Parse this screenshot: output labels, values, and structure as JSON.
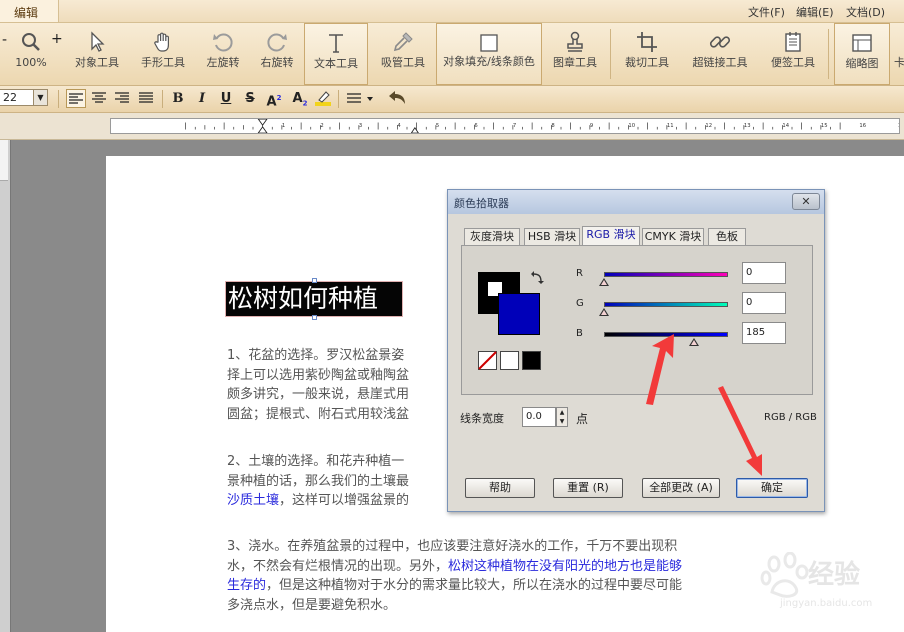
{
  "menubar": {
    "tab_label": "编辑",
    "items": [
      "文件(F)",
      "编辑(E)",
      "文档(D)"
    ]
  },
  "toolbar": {
    "zoom": {
      "minus": "-",
      "plus": "+",
      "value": "100%"
    },
    "tools": [
      {
        "label": "对象工具",
        "icon": "cursor-icon"
      },
      {
        "label": "手形工具",
        "icon": "hand-icon"
      },
      {
        "label": "左旋转",
        "icon": "rotate-left-icon"
      },
      {
        "label": "右旋转",
        "icon": "rotate-right-icon"
      },
      {
        "label": "文本工具",
        "icon": "text-icon"
      },
      {
        "label": "吸管工具",
        "icon": "eyedropper-icon"
      },
      {
        "label": "对象填充/线条颜色",
        "icon": "fill-box-icon"
      },
      {
        "label": "图章工具",
        "icon": "stamp-icon"
      },
      {
        "label": "裁切工具",
        "icon": "crop-icon"
      },
      {
        "label": "超链接工具",
        "icon": "link-icon"
      },
      {
        "label": "便签工具",
        "icon": "note-icon"
      },
      {
        "label": "缩略图",
        "icon": "thumbnail-icon"
      },
      {
        "label": "卡",
        "icon": "card-icon"
      }
    ]
  },
  "formatbar": {
    "font_size": "22",
    "bold": "B",
    "italic": "I",
    "underline": "U",
    "strike": "S",
    "superscript": "A",
    "subscript": "A",
    "sup_mark": "2",
    "sub_mark": "2"
  },
  "ruler": {
    "numbers": [
      "1",
      "2",
      "3",
      "4",
      "5",
      "6",
      "7",
      "8",
      "9",
      "10",
      "11",
      "12",
      "13",
      "14",
      "15",
      "16",
      "17"
    ]
  },
  "document": {
    "title": "松树如何种植",
    "para1": [
      "1、花盆的选择。罗汉松盆景姿",
      "择上可以选用紫砂陶盆或釉陶盆",
      "颇多讲究，一般来说，悬崖式用",
      "圆盆；提根式、附石式用较浅盆"
    ],
    "para2_lines": [
      "2、土壤的选择。和花卉种植一",
      "景种植的话，那么我们的土壤最"
    ],
    "para2_last_blue": "沙质土壤",
    "para2_last_rest": "，这样可以增强盆景的",
    "para3_line1": "3、浇水。在养殖盆景的过程中，也应该要注意好浇水的工作，千万不要出现积",
    "para3_line2_plain": "水，不然会有烂根情况的出现。另外，",
    "para3_line2_blue": "松树这种植物在没有阳光的地方也是能够",
    "para3_line3_blue": "生存的",
    "para3_line3_rest": "，但是这种植物对于水分的需求量比较大，所以在浇水的过程中要尽可能",
    "para3_line4": "多浇点水，但是要避免积水。"
  },
  "dialog": {
    "title": "颜色拾取器",
    "close_label": "✕",
    "tabs": [
      "灰度滑块",
      "HSB 滑块",
      "RGB 滑块",
      "CMYK 滑块",
      "色板"
    ],
    "selected_tab": "RGB 滑块",
    "rgb": {
      "r_label": "R",
      "g_label": "G",
      "b_label": "B",
      "r": "0",
      "g": "0",
      "b": "185"
    },
    "color_value": {
      "r": 0,
      "g": 0,
      "b": 185
    },
    "fill_color": "#0000b9",
    "stroke_color": "#000000",
    "line_width_label": "线条宽度",
    "line_width_value": "0.0",
    "line_width_unit": "点",
    "mode_label": "RGB / RGB",
    "buttons": {
      "help": "帮助",
      "reset": "重置 (R)",
      "change_all": "全部更改 (A)",
      "ok": "确定"
    }
  },
  "watermark": {
    "brand": "经验",
    "url": "jingyan.baidu.com"
  }
}
